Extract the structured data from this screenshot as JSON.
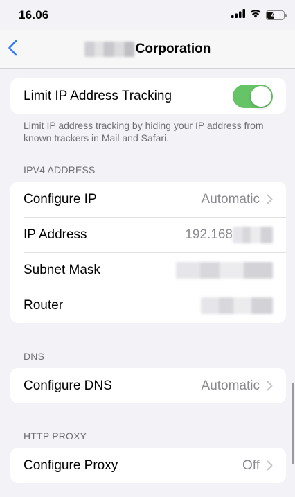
{
  "status_bar": {
    "time": "16.06",
    "battery_level": "45",
    "battery_fraction": 0.45
  },
  "nav": {
    "back_icon": "chevron-left-icon",
    "title": "Corporation",
    "accent_color": "#2f7cf6"
  },
  "limit_tracking": {
    "label": "Limit IP Address Tracking",
    "enabled": true,
    "toggle_color": "#65c466",
    "footer": "Limit IP address tracking by hiding your IP address from known trackers in Mail and Safari."
  },
  "ipv4": {
    "header": "IPV4 ADDRESS",
    "configure_ip": {
      "label": "Configure IP",
      "value": "Automatic"
    },
    "ip_address": {
      "label": "IP Address",
      "value": "192.168"
    },
    "subnet_mask": {
      "label": "Subnet Mask"
    },
    "router": {
      "label": "Router"
    }
  },
  "dns": {
    "header": "DNS",
    "configure_dns": {
      "label": "Configure DNS",
      "value": "Automatic"
    }
  },
  "http_proxy": {
    "header": "HTTP PROXY",
    "configure_proxy": {
      "label": "Configure Proxy",
      "value": "Off"
    }
  }
}
